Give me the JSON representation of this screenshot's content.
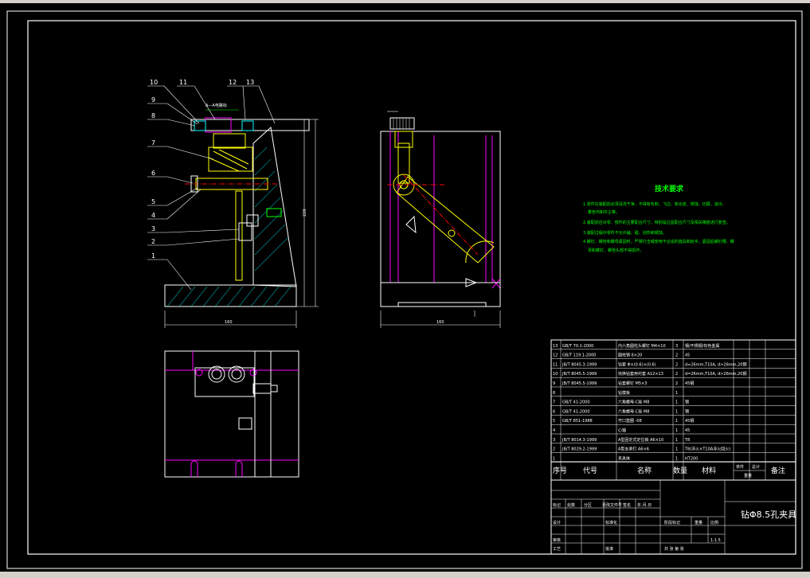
{
  "balloons": [
    "10",
    "11",
    "12",
    "13",
    "9",
    "8",
    "7",
    "6",
    "5",
    "4",
    "3",
    "2",
    "1"
  ],
  "dimensions": {
    "front_width": "160",
    "front_height": "220",
    "side_width": "160",
    "note_top": "A—A电路标"
  },
  "tech_requirements": {
    "title": "技术要求",
    "lines": [
      "1.零件在装配前必须清洗干净，不得有毛刺、飞边、氧化皮、锈蚀、切屑、油污、",
      "着色剂和灰尘等。",
      "2.装配前应对零、部件的主要配合尺寸，特别是过盈配合尺寸及相关精度进行复查。",
      "3.装配过程中零件不允许磕、碰、划伤和锈蚀。",
      "4.螺钉、螺栓和螺母紧固时，严禁打击或使用不合适的旋具和扳手。紧固后螺钉槽、螺",
      "母和螺钉、螺栓头部不得损坏。"
    ]
  },
  "parts_list": [
    {
      "no": "13",
      "code": "GB/T 70.1-2000",
      "name": "内六角圆柱头螺钉 M4×10",
      "qty": "3",
      "mat": "钢/不锈钢/有色金属"
    },
    {
      "no": "12",
      "code": "GB/T 119.1-2000",
      "name": "圆柱销 6×20",
      "qty": "2",
      "mat": "45"
    },
    {
      "no": "11",
      "code": "JB/T 8045.3-1999",
      "name": "钻套 Φ×(0.6)×(0.6)",
      "qty": "2",
      "mat": "d=26mm,T10A, d>26mm,20钢"
    },
    {
      "no": "10",
      "code": "JB/T 8045.5-1999",
      "name": "快换钻套用衬套 A12×13",
      "qty": "2",
      "mat": "d=26mm,T10A, d>26mm,20钢"
    },
    {
      "no": "9",
      "code": "JB/T 8045.5-1999",
      "name": "钻套螺钉 M5×3",
      "qty": "2",
      "mat": "45钢"
    },
    {
      "no": "8",
      "code": "",
      "name": "钻模板",
      "qty": "1",
      "mat": ""
    },
    {
      "no": "7",
      "code": "GB/T 41-2000",
      "name": "六角螺母-C级 M8",
      "qty": "1",
      "mat": "钢"
    },
    {
      "no": "6",
      "code": "GB/T 41-2000",
      "name": "六角螺母-C级 M8",
      "qty": "1",
      "mat": "钢"
    },
    {
      "no": "5",
      "code": "GB/T 851-1988",
      "name": "开口垫圈 -08",
      "qty": "1",
      "mat": "45钢"
    },
    {
      "no": "4",
      "code": "",
      "name": "心轴",
      "qty": "1",
      "mat": "45"
    },
    {
      "no": "3",
      "code": "JB/T 8014.3-1999",
      "name": "A型固定式定位销 A6×10",
      "qty": "1",
      "mat": "T8"
    },
    {
      "no": "2",
      "code": "JB/T 8029.2-1999",
      "name": "A型支承钉 A6×6",
      "qty": "1",
      "mat": "T8(淬火×T10A淬火回火)"
    },
    {
      "no": "1",
      "code": "",
      "name": "夹具体",
      "qty": "1",
      "mat": "HT200"
    }
  ],
  "parts_header": {
    "no": "序号",
    "code": "代号",
    "name": "名称",
    "qty": "数量",
    "mat": "材料",
    "unit": "单件",
    "total": "总计",
    "weight": "重量",
    "remark": "备注"
  },
  "title_block": {
    "drawing_title": "钻Φ8.5孔夹具",
    "scale": "1:1.5",
    "rev_labels": [
      "标记",
      "处数",
      "分区",
      "更改文件号",
      "签名",
      "年.月.日"
    ],
    "design": "设计",
    "standard": "标准化",
    "check": "审核",
    "process": "工艺",
    "approve": "批准",
    "stage": "阶段标记",
    "weight": "重量",
    "ratio": "比例",
    "sheets": "共  张  第  张"
  }
}
